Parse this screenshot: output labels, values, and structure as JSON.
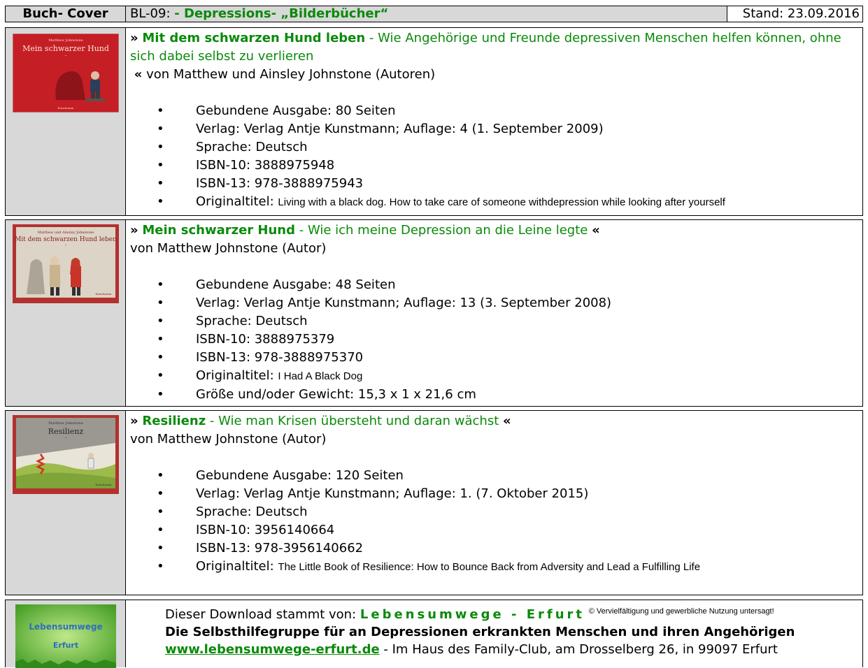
{
  "header": {
    "col1": "Buch- Cover",
    "code": "BL-09:",
    "title": "- Depressions- „Bilderbücher“",
    "stand": "Stand: 23.09.2016"
  },
  "books": [
    {
      "cover_title": "Mein schwarzer Hund",
      "title_bold": "Mit dem schwarzen Hund leben",
      "title_rest": " - Wie Angehörige und Freunde depressiven Menschen helfen können, ohne sich dabei selbst zu verlieren",
      "open_q": "»",
      "close_q": "«",
      "authors": "von Matthew und Ainsley Johnstone (Autoren)",
      "bullets": [
        "Gebundene Ausgabe: 80 Seiten",
        "Verlag: Verlag Antje Kunstmann; Auflage: 4 (1. September 2009)",
        "Sprache: Deutsch",
        "ISBN-10: 3888975948",
        "ISBN-13: 978-3888975943"
      ],
      "orig_label": "Originaltitel: ",
      "orig_value": "Living with a black dog. How to take care of someone withdepression while looking after yourself"
    },
    {
      "cover_title": "Mit dem schwarzen Hund leben",
      "title_bold": "Mein schwarzer Hund",
      "title_rest": " - Wie ich meine Depression an die Leine legte ",
      "open_q": "»",
      "close_q": "«",
      "authors": "von Matthew Johnstone  (Autor)",
      "bullets": [
        "Gebundene Ausgabe: 48 Seiten",
        "Verlag: Verlag Antje Kunstmann; Auflage: 13 (3. September 2008)",
        "Sprache: Deutsch",
        "ISBN-10: 3888975379",
        "ISBN-13: 978-3888975370"
      ],
      "orig_label": "Originaltitel: ",
      "orig_value": "I Had A Black Dog",
      "extra": "Größe und/oder Gewicht: 15,3 x 1 x 21,6 cm"
    },
    {
      "cover_title": "Resilienz",
      "title_bold": "Resilienz",
      "title_rest": " - Wie man Krisen übersteht und daran wächst ",
      "open_q": "»",
      "close_q": "«",
      "authors": "von Matthew Johnstone  (Autor)",
      "bullets": [
        "Gebundene Ausgabe: 120 Seiten",
        "Verlag: Verlag Antje Kunstmann; Auflage: 1. (7. Oktober 2015)",
        "Sprache: Deutsch",
        "ISBN-10: 3956140664",
        "ISBN-13: 978-3956140662"
      ],
      "orig_label": "Originaltitel: ",
      "orig_value": "The Little Book of Resilience: How to Bounce Back from Adversity and Lead a Fulfilling Life"
    }
  ],
  "footer": {
    "logo_line1": "Lebensumwege",
    "logo_line2": "Erfurt",
    "download_text": "Dieser Download stammt von: ",
    "brand": "Lebensumwege - Erfurt",
    "copyright": "© Vervielfältigung und gewerbliche Nutzung untersagt!",
    "group": "Die Selbsthilfegruppe für an Depressionen erkrankten Menschen und ihren Angehörigen",
    "url": "www.lebensumwege-erfurt.de",
    "address": " - Im Haus des Family-Club, am Drosselberg 26, in 99097 Erfurt"
  }
}
